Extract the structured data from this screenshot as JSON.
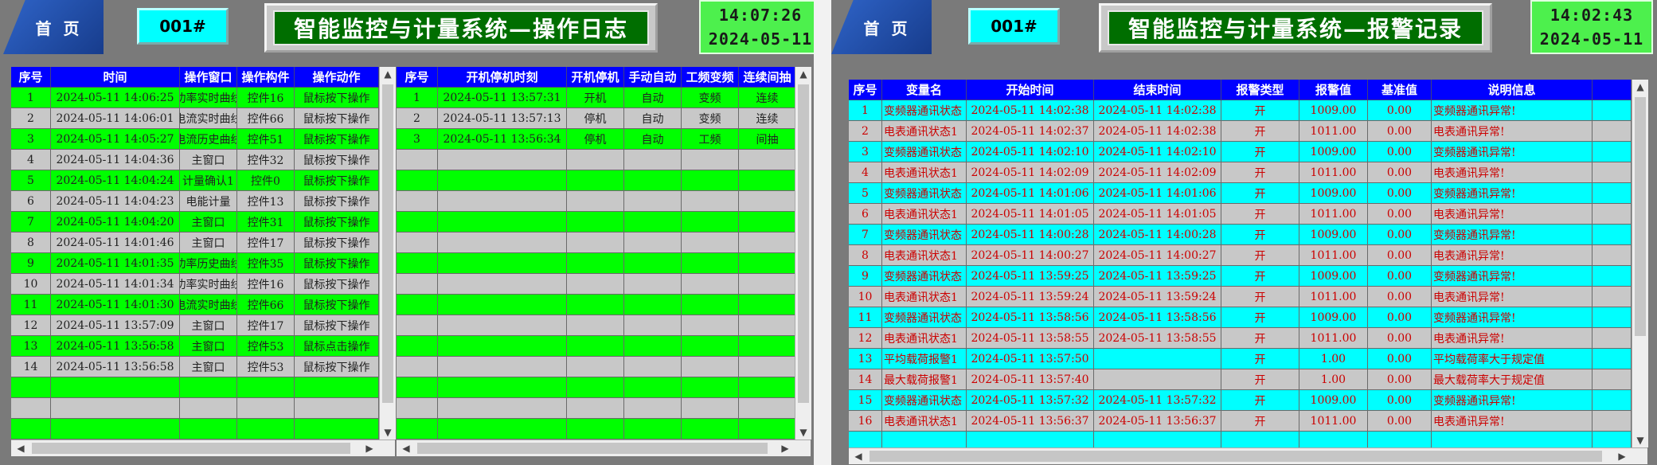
{
  "left": {
    "home_label": "首  页",
    "device_id": "001#",
    "title": "智能监控与计量系统—操作日志",
    "clock": {
      "time": "14:07:26",
      "date": "2024-05-11"
    },
    "op_table": {
      "headers": [
        "序号",
        "时间",
        "操作窗口",
        "操作构件",
        "操作动作"
      ],
      "rows": [
        [
          "1",
          "2024-05-11 14:06:25",
          "功率实时曲线",
          "控件16",
          "鼠标按下操作"
        ],
        [
          "2",
          "2024-05-11 14:06:01",
          "电流实时曲线",
          "控件66",
          "鼠标按下操作"
        ],
        [
          "3",
          "2024-05-11 14:05:27",
          "电流历史曲线",
          "控件51",
          "鼠标按下操作"
        ],
        [
          "4",
          "2024-05-11 14:04:36",
          "主窗口",
          "控件32",
          "鼠标按下操作"
        ],
        [
          "5",
          "2024-05-11 14:04:24",
          "计量确认1",
          "控件0",
          "鼠标按下操作"
        ],
        [
          "6",
          "2024-05-11 14:04:23",
          "电能计量",
          "控件13",
          "鼠标按下操作"
        ],
        [
          "7",
          "2024-05-11 14:04:20",
          "主窗口",
          "控件31",
          "鼠标按下操作"
        ],
        [
          "8",
          "2024-05-11 14:01:46",
          "主窗口",
          "控件17",
          "鼠标按下操作"
        ],
        [
          "9",
          "2024-05-11 14:01:35",
          "功率历史曲线",
          "控件35",
          "鼠标按下操作"
        ],
        [
          "10",
          "2024-05-11 14:01:34",
          "功率实时曲线",
          "控件16",
          "鼠标按下操作"
        ],
        [
          "11",
          "2024-05-11 14:01:30",
          "电流实时曲线",
          "控件66",
          "鼠标按下操作"
        ],
        [
          "12",
          "2024-05-11 13:57:09",
          "主窗口",
          "控件17",
          "鼠标按下操作"
        ],
        [
          "13",
          "2024-05-11 13:56:58",
          "主窗口",
          "控件53",
          "鼠标点击操作"
        ],
        [
          "14",
          "2024-05-11 13:56:58",
          "主窗口",
          "控件53",
          "鼠标按下操作"
        ]
      ]
    },
    "run_table": {
      "headers": [
        "序号",
        "开机停机时刻",
        "开机停机",
        "手动自动",
        "工频变频",
        "连续间抽"
      ],
      "rows": [
        [
          "1",
          "2024-05-11 13:57:31",
          "开机",
          "自动",
          "变频",
          "连续"
        ],
        [
          "2",
          "2024-05-11 13:57:13",
          "停机",
          "自动",
          "变频",
          "连续"
        ],
        [
          "3",
          "2024-05-11 13:56:34",
          "停机",
          "自动",
          "工频",
          "间抽"
        ]
      ]
    }
  },
  "right": {
    "home_label": "首  页",
    "device_id": "001#",
    "title": "智能监控与计量系统—报警记录",
    "clock": {
      "time": "14:02:43",
      "date": "2024-05-11"
    },
    "alarm_table": {
      "headers": [
        "序号",
        "变量名",
        "开始时间",
        "结束时间",
        "报警类型",
        "报警值",
        "基准值",
        "说明信息"
      ],
      "rows": [
        [
          "1",
          "变频器通讯状态",
          "2024-05-11 14:02:38",
          "2024-05-11 14:02:38",
          "开",
          "1009.00",
          "0.00",
          "变频器通讯异常!"
        ],
        [
          "2",
          "电表通讯状态1",
          "2024-05-11 14:02:37",
          "2024-05-11 14:02:38",
          "开",
          "1011.00",
          "0.00",
          "电表通讯异常!"
        ],
        [
          "3",
          "变频器通讯状态",
          "2024-05-11 14:02:10",
          "2024-05-11 14:02:10",
          "开",
          "1009.00",
          "0.00",
          "变频器通讯异常!"
        ],
        [
          "4",
          "电表通讯状态1",
          "2024-05-11 14:02:09",
          "2024-05-11 14:02:09",
          "开",
          "1011.00",
          "0.00",
          "电表通讯异常!"
        ],
        [
          "5",
          "变频器通讯状态",
          "2024-05-11 14:01:06",
          "2024-05-11 14:01:06",
          "开",
          "1009.00",
          "0.00",
          "变频器通讯异常!"
        ],
        [
          "6",
          "电表通讯状态1",
          "2024-05-11 14:01:05",
          "2024-05-11 14:01:05",
          "开",
          "1011.00",
          "0.00",
          "电表通讯异常!"
        ],
        [
          "7",
          "变频器通讯状态",
          "2024-05-11 14:00:28",
          "2024-05-11 14:00:28",
          "开",
          "1009.00",
          "0.00",
          "变频器通讯异常!"
        ],
        [
          "8",
          "电表通讯状态1",
          "2024-05-11 14:00:27",
          "2024-05-11 14:00:27",
          "开",
          "1011.00",
          "0.00",
          "电表通讯异常!"
        ],
        [
          "9",
          "变频器通讯状态",
          "2024-05-11 13:59:25",
          "2024-05-11 13:59:25",
          "开",
          "1009.00",
          "0.00",
          "变频器通讯异常!"
        ],
        [
          "10",
          "电表通讯状态1",
          "2024-05-11 13:59:24",
          "2024-05-11 13:59:24",
          "开",
          "1011.00",
          "0.00",
          "电表通讯异常!"
        ],
        [
          "11",
          "变频器通讯状态",
          "2024-05-11 13:58:56",
          "2024-05-11 13:58:56",
          "开",
          "1009.00",
          "0.00",
          "变频器通讯异常!"
        ],
        [
          "12",
          "电表通讯状态1",
          "2024-05-11 13:58:55",
          "2024-05-11 13:58:55",
          "开",
          "1011.00",
          "0.00",
          "电表通讯异常!"
        ],
        [
          "13",
          "平均载荷报警1",
          "2024-05-11 13:57:50",
          "",
          "开",
          "1.00",
          "0.00",
          "平均载荷率大于规定值"
        ],
        [
          "14",
          "最大载荷报警1",
          "2024-05-11 13:57:40",
          "",
          "开",
          "1.00",
          "0.00",
          "最大载荷率大于规定值"
        ],
        [
          "15",
          "变频器通讯状态",
          "2024-05-11 13:57:32",
          "2024-05-11 13:57:32",
          "开",
          "1009.00",
          "0.00",
          "变频器通讯异常!"
        ],
        [
          "16",
          "电表通讯状态1",
          "2024-05-11 13:56:37",
          "2024-05-11 13:56:37",
          "开",
          "1011.00",
          "0.00",
          "电表通讯异常!"
        ]
      ]
    }
  },
  "colors": {
    "green_row": "#00ff00",
    "gray_row": "#c8c8c8",
    "cyan_row": "#00ffff",
    "header": "#0000ff",
    "alarm_text": "#cc0000",
    "title_bg": "#006e00"
  },
  "icons": {
    "scroll_up": "▲",
    "scroll_down": "▼",
    "scroll_left": "◀",
    "scroll_right": "▶"
  }
}
